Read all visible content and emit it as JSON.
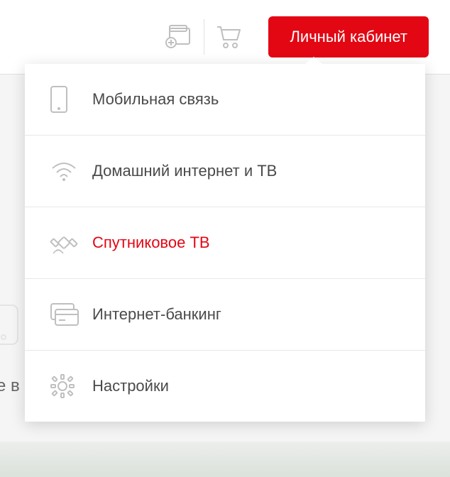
{
  "header": {
    "accountButton": "Личный кабинет"
  },
  "menu": {
    "items": [
      {
        "label": "Мобильная связь",
        "icon": "phone",
        "active": false
      },
      {
        "label": "Домашний интернет и ТВ",
        "icon": "wifi",
        "active": false
      },
      {
        "label": "Спутниковое ТВ",
        "icon": "satellite",
        "active": true
      },
      {
        "label": "Интернет-банкинг",
        "icon": "card",
        "active": false
      },
      {
        "label": "Настройки",
        "icon": "gear",
        "active": false
      }
    ]
  },
  "background": {
    "partialText": "е в"
  },
  "colors": {
    "accent": "#e30613",
    "text": "#4a4a4a",
    "iconGray": "#bfbfbf",
    "border": "#e8e8e8"
  }
}
